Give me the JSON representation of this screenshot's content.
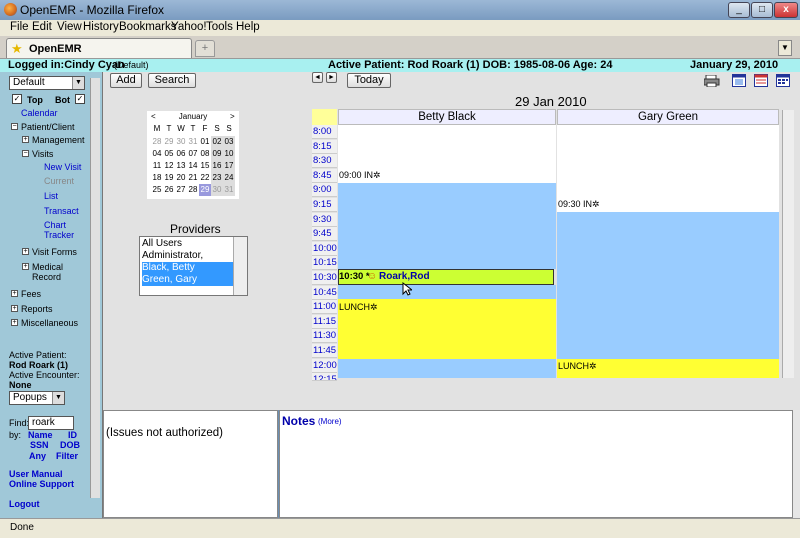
{
  "window": {
    "title": "OpenEMR - Mozilla Firefox"
  },
  "menu": [
    "File",
    "Edit",
    "View",
    "History",
    "Bookmarks",
    "Yahoo!",
    "Tools",
    "Help"
  ],
  "tabs": {
    "active": "OpenEMR",
    "new_tab": "+"
  },
  "header": {
    "logged_in": "Logged in:Cindy Cyan",
    "facility": "(Default)",
    "active_patient": "Active Patient: Rod Roark (1) DOB: 1985-08-06 Age: 24",
    "date": "January 29, 2010"
  },
  "nav": {
    "profile": "Default",
    "top_label": "Top",
    "bot_label": "Bot",
    "calendar": "Calendar",
    "patient_client": "Patient/Client",
    "management": "Management",
    "visits": "Visits",
    "new_visit": "New Visit",
    "current": "Current",
    "list": "List",
    "transact": "Transact",
    "chart": "Chart",
    "tracker": "Tracker",
    "visit_forms": "Visit Forms",
    "medical": "Medical",
    "record": "Record",
    "fees": "Fees",
    "reports": "Reports",
    "misc": "Miscellaneous",
    "active_patient_label": "Active Patient:",
    "active_patient": "Rod Roark (1)",
    "active_encounter_label": "Active Encounter:",
    "active_encounter": "None",
    "popups": "Popups",
    "find_label": "Find:",
    "find_value": "roark",
    "by_label": "by:",
    "by_name": "Name",
    "by_id": "ID",
    "by_ssn": "SSN",
    "by_dob": "DOB",
    "by_any": "Any",
    "by_filter": "Filter",
    "user_manual": "User Manual",
    "online_support": "Online Support",
    "logout": "Logout"
  },
  "toolbar": {
    "add": "Add",
    "search": "Search",
    "today": "Today",
    "prev": "◄",
    "next": "►"
  },
  "mini_calendar": {
    "month": "January",
    "prev": "<",
    "next": ">",
    "dow": [
      "M",
      "T",
      "W",
      "T",
      "F",
      "S",
      "S"
    ],
    "weeks": [
      [
        "28",
        "29",
        "30",
        "31",
        "01",
        "02",
        "03"
      ],
      [
        "04",
        "05",
        "06",
        "07",
        "08",
        "09",
        "10"
      ],
      [
        "11",
        "12",
        "13",
        "14",
        "15",
        "16",
        "17"
      ],
      [
        "18",
        "19",
        "20",
        "21",
        "22",
        "23",
        "24"
      ],
      [
        "25",
        "26",
        "27",
        "28",
        "29",
        "30",
        "31"
      ]
    ],
    "today": "29"
  },
  "providers": {
    "title": "Providers",
    "items": [
      "All Users",
      "Administrator,",
      "Black, Betty",
      "Green, Gary"
    ],
    "selected": [
      "Black, Betty",
      "Green, Gary"
    ]
  },
  "schedule": {
    "date": "29 Jan 2010",
    "times": [
      "8:00",
      "8:15",
      "8:30",
      "8:45",
      "9:00",
      "9:15",
      "9:30",
      "9:45",
      "10:00",
      "10:15",
      "10:30",
      "10:45",
      "11:00",
      "11:15",
      "11:30",
      "11:45",
      "12:00",
      "12:15"
    ],
    "columns": [
      "Betty Black",
      "Gary Green"
    ],
    "appts": {
      "betty_in": "09:00 IN",
      "gary_in": "09:30 IN",
      "rod_time": "10:30 *",
      "rod_name": "Roark,Rod",
      "betty_lunch": "LUNCH",
      "gary_lunch": "LUNCH"
    },
    "colors": {
      "in_office": "#99ccff",
      "lunch": "#ffff33",
      "appointment": "#ccff33"
    }
  },
  "issues": {
    "text": "(Issues not authorized)"
  },
  "notes": {
    "title": "Notes",
    "more": "(More)"
  },
  "status": "Done"
}
